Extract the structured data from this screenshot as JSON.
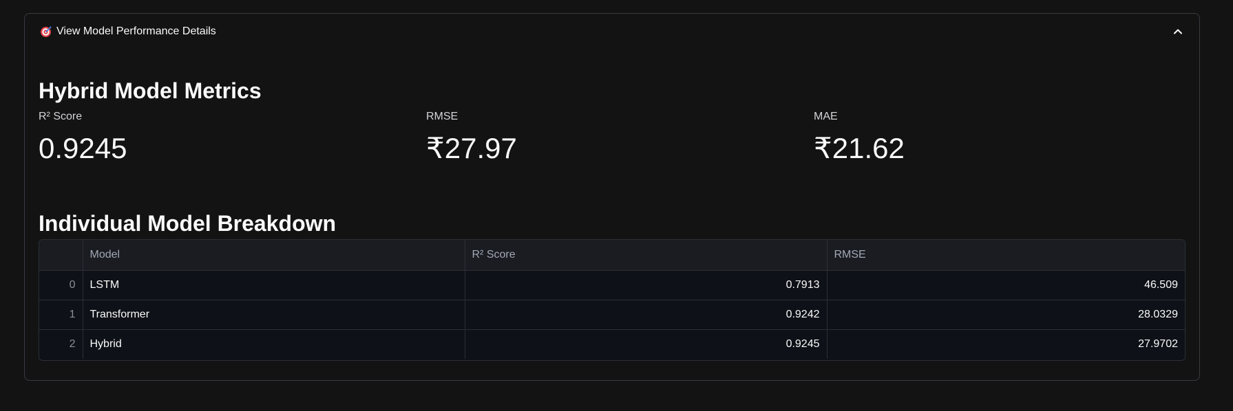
{
  "expander": {
    "icon": "target-icon",
    "title": "View Model Performance Details",
    "toggle_icon": "chevron-up-icon"
  },
  "hybrid_section": {
    "heading": "Hybrid Model Metrics",
    "metrics": [
      {
        "label": "R² Score",
        "value": "0.9245"
      },
      {
        "label": "RMSE",
        "value": "₹27.97"
      },
      {
        "label": "MAE",
        "value": "₹21.62"
      }
    ]
  },
  "breakdown_section": {
    "heading": "Individual Model Breakdown",
    "table": {
      "columns": [
        "",
        "Model",
        "R² Score",
        "RMSE"
      ],
      "rows": [
        {
          "index": "0",
          "model": "LSTM",
          "r2": "0.7913",
          "rmse": "46.509"
        },
        {
          "index": "1",
          "model": "Transformer",
          "r2": "0.9242",
          "rmse": "28.0329"
        },
        {
          "index": "2",
          "model": "Hybrid",
          "r2": "0.9245",
          "rmse": "27.9702"
        }
      ]
    }
  }
}
